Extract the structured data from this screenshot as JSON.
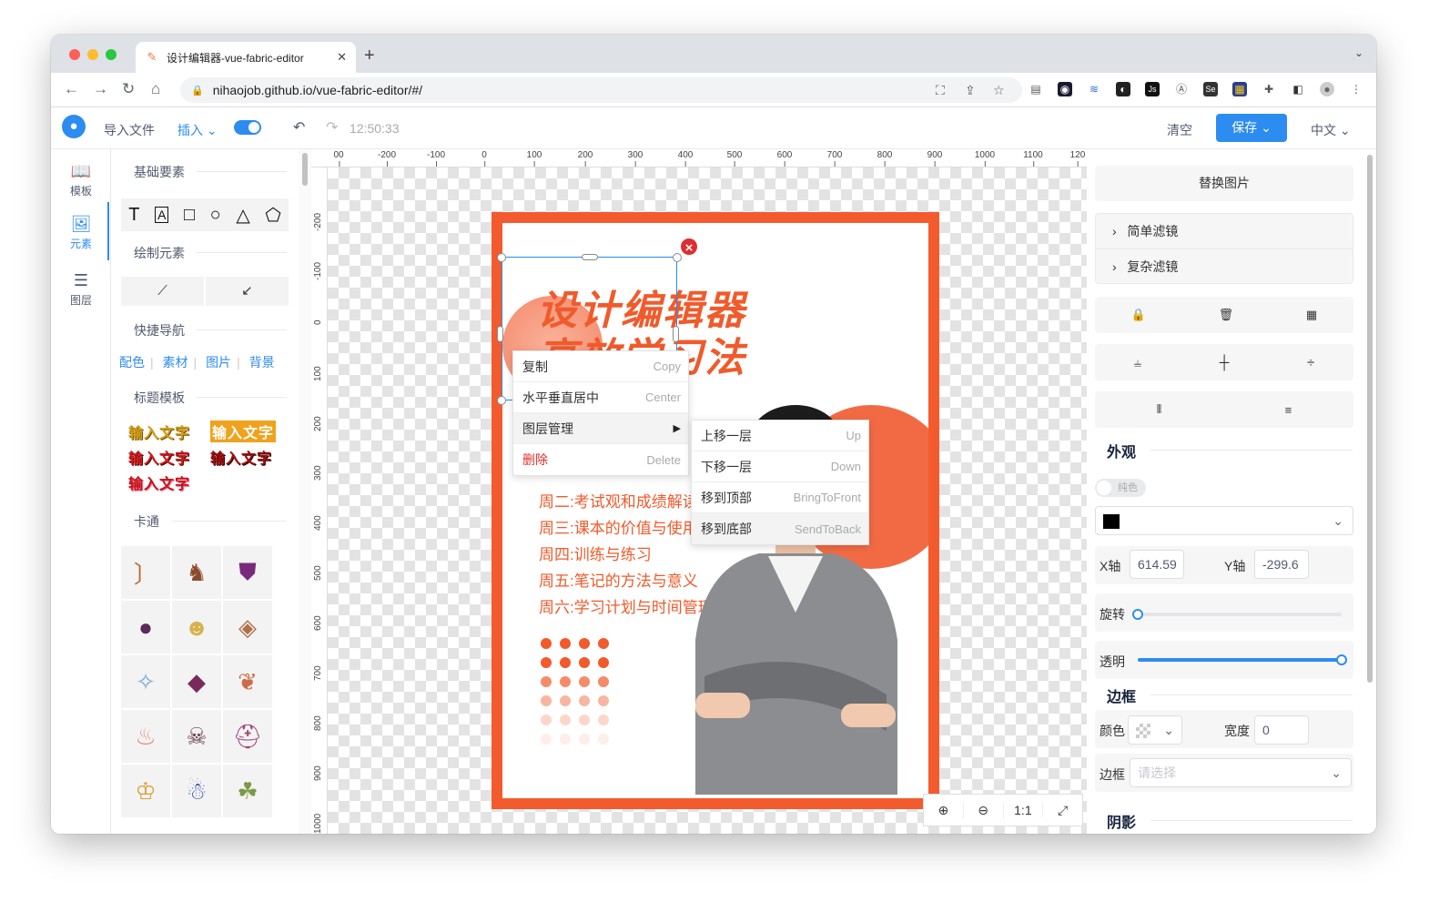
{
  "browser": {
    "tab_title": "设计编辑器-vue-fabric-editor",
    "url": "nihaojob.github.io/vue-fabric-editor/#/"
  },
  "toolbar": {
    "import_label": "导入文件",
    "insert_label": "插入",
    "time": "12:50:33",
    "clear_label": "清空",
    "save_label": "保存",
    "lang_label": "中文"
  },
  "leftnav": {
    "items": [
      {
        "label": "模板",
        "icon": "book-icon"
      },
      {
        "label": "元素",
        "icon": "image-icon"
      },
      {
        "label": "图层",
        "icon": "layers-icon"
      }
    ]
  },
  "leftpanel": {
    "basic_title": "基础要素",
    "draw_title": "绘制元素",
    "nav_title": "快捷导航",
    "quick_links": [
      "配色",
      "素材",
      "图片",
      "背景"
    ],
    "template_title": "标题模板",
    "template_text": "输入文字",
    "cartoon_title": "卡通"
  },
  "ruler": {
    "x_ticks": [
      "00",
      "-200",
      "-100",
      "0",
      "100",
      "200",
      "300",
      "400",
      "500",
      "600",
      "700",
      "800",
      "900",
      "1000",
      "1100",
      "120"
    ],
    "y_ticks": [
      "-200",
      "-100",
      "0",
      "100",
      "200",
      "300",
      "400",
      "500",
      "600",
      "700",
      "800",
      "900",
      "1000"
    ]
  },
  "poster": {
    "title_line1": "设计编辑器",
    "title_line2": "高效学习法",
    "weeks": [
      "周二:考试观和成绩解读",
      "周三:课本的价值与使用",
      "周四:训练与练习",
      "周五:笔记的方法与意义",
      "周六:学习计划与时间管理"
    ]
  },
  "context_menu": {
    "items": [
      {
        "label": "复制",
        "shortcut": "Copy"
      },
      {
        "label": "水平垂直居中",
        "shortcut": "Center"
      },
      {
        "label": "图层管理",
        "shortcut": "▶"
      },
      {
        "label": "删除",
        "shortcut": "Delete"
      }
    ],
    "submenu": [
      {
        "label": "上移一层",
        "shortcut": "Up"
      },
      {
        "label": "下移一层",
        "shortcut": "Down"
      },
      {
        "label": "移到顶部",
        "shortcut": "BringToFront"
      },
      {
        "label": "移到底部",
        "shortcut": "SendToBack"
      }
    ]
  },
  "zoom": {
    "ratio_label": "1:1"
  },
  "rightpanel": {
    "replace_image": "替换图片",
    "simple_filter": "简单滤镜",
    "complex_filter": "复杂滤镜",
    "appearance_title": "外观",
    "solid_label": "纯色",
    "x_label": "X轴",
    "x_value": "614.59",
    "y_label": "Y轴",
    "y_value": "-299.6",
    "rotate_label": "旋转",
    "rotate_value": 0,
    "opacity_label": "透明",
    "opacity_value": 1,
    "border_title": "边框",
    "color_label": "颜色",
    "width_label": "宽度",
    "width_value": "0",
    "border_label": "边框",
    "border_placeholder": "请选择",
    "shadow_title": "阴影"
  },
  "colors": {
    "accent": "#2d8cf0",
    "poster_orange": "#f15a2b",
    "danger": "#e12d2d"
  }
}
